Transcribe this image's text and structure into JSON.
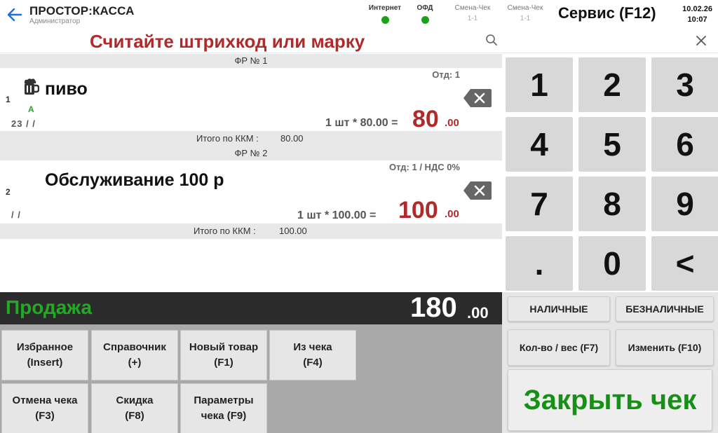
{
  "header": {
    "app_title": "ПРОСТОР:КАССА",
    "user": "Администратор",
    "status_internet": "Интернет",
    "status_ofd": "ОФД",
    "shift1_label": "Смена-Чек",
    "shift1_value": "1-1",
    "shift2_label": "Смена-Чек",
    "shift2_value": "1-1",
    "service": "Сервис (F12)",
    "date": "10.02.26",
    "time": "10:07",
    "status_ok_color": "#17a317"
  },
  "scan": {
    "prompt": "Считайте штрихкод или марку"
  },
  "receipt": {
    "groups": [
      {
        "fr_label": "ФР № 1",
        "item": {
          "index": "1",
          "dept": "Отд: 1",
          "name": "пиво",
          "tag": "А",
          "codes": "23 /  /",
          "qty": "1 шт * 80.00 =",
          "price_int": "80",
          "price_dec": ".00",
          "icon": "beer-mug-icon"
        },
        "subtotal_label": "Итого по ККМ :",
        "subtotal_value": "80.00"
      },
      {
        "fr_label": "ФР № 2",
        "item": {
          "index": "2",
          "dept": "Отд: 1 / НДС 0%",
          "name": "Обслуживание 100 р",
          "codes": "/  /",
          "qty": "1 шт * 100.00 =",
          "price_int": "100",
          "price_dec": ".00"
        },
        "subtotal_label": "Итого по ККМ :",
        "subtotal_value": "100.00"
      }
    ]
  },
  "numpad": [
    "1",
    "2",
    "3",
    "4",
    "5",
    "6",
    "7",
    "8",
    "9",
    ".",
    "0",
    "<"
  ],
  "totals": {
    "mode": "Продажа",
    "total_int": "180",
    "total_dec": ".00"
  },
  "payment": {
    "cash": "НАЛИЧНЫЕ",
    "card": "БЕЗНАЛИЧНЫЕ",
    "qty": "Кол-во / вес (F7)",
    "edit": "Изменить (F10)",
    "close": "Закрыть чек"
  },
  "functions": {
    "favorites": [
      "Избранное",
      "(Insert)"
    ],
    "catalog": [
      "Справочник",
      "(+)"
    ],
    "new_item": [
      "Новый товар",
      "(F1)"
    ],
    "from_check": [
      "Из чека",
      "(F4)"
    ],
    "cancel_check": [
      "Отмена чека",
      "(F3)"
    ],
    "discount": [
      "Скидка",
      "(F8)"
    ],
    "params": [
      "Параметры",
      "чека (F9)"
    ]
  },
  "colors": {
    "accent_red": "#b02a2a",
    "accent_green": "#169016",
    "back_blue": "#1e6fd9"
  }
}
